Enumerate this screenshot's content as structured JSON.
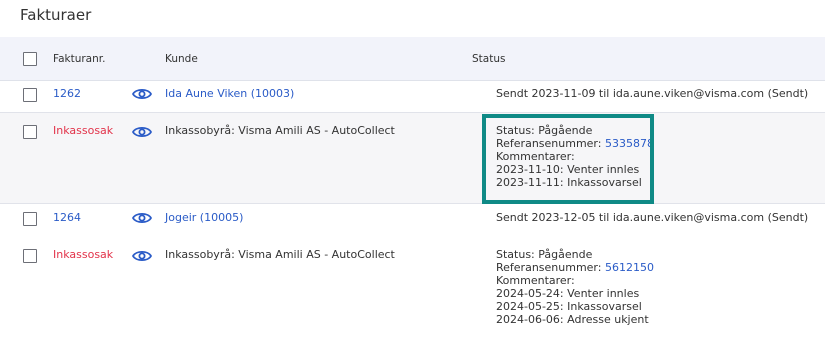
{
  "page": {
    "title": "Fakturaer"
  },
  "table": {
    "headers": {
      "number": "Fakturanr.",
      "customer": "Kunde",
      "status": "Status"
    },
    "rows": [
      {
        "number": "1262",
        "customer": "Ida Aune Viken (10003)",
        "status": "Sendt 2023-11-09 til ida.aune.viken@visma.com (Sendt)"
      },
      {
        "number": "Inkassosak",
        "customer": "Inkassobyrå: Visma Amili AS - AutoCollect",
        "status_lines": {
          "status": "Status: Pågående",
          "ref_label": "Referansenummer: ",
          "ref_value": "5335878",
          "comments": "Kommentarer:",
          "c1": "2023-11-10: Venter innles",
          "c2": "2023-11-11: Inkassovarsel"
        }
      },
      {
        "number": "1264",
        "customer": "Jogeir (10005)",
        "status": "Sendt 2023-12-05 til ida.aune.viken@visma.com (Sendt)"
      },
      {
        "number": "Inkassosak",
        "customer": "Inkassobyrå: Visma Amili AS - AutoCollect",
        "status_lines": {
          "status": "Status: Pågående",
          "ref_label": "Referansenummer: ",
          "ref_value": "5612150",
          "comments": "Kommentarer:",
          "c1": "2024-05-24: Venter innles",
          "c2": "2024-05-25: Inkassovarsel",
          "c3": "2024-06-06: Adresse ukjent"
        }
      }
    ]
  },
  "colors": {
    "link": "#2a5bc7",
    "collection": "#e2334a",
    "highlight": "#0f8a86",
    "header_bg": "#f2f3fa"
  },
  "icons": {
    "view": "eye-icon"
  }
}
